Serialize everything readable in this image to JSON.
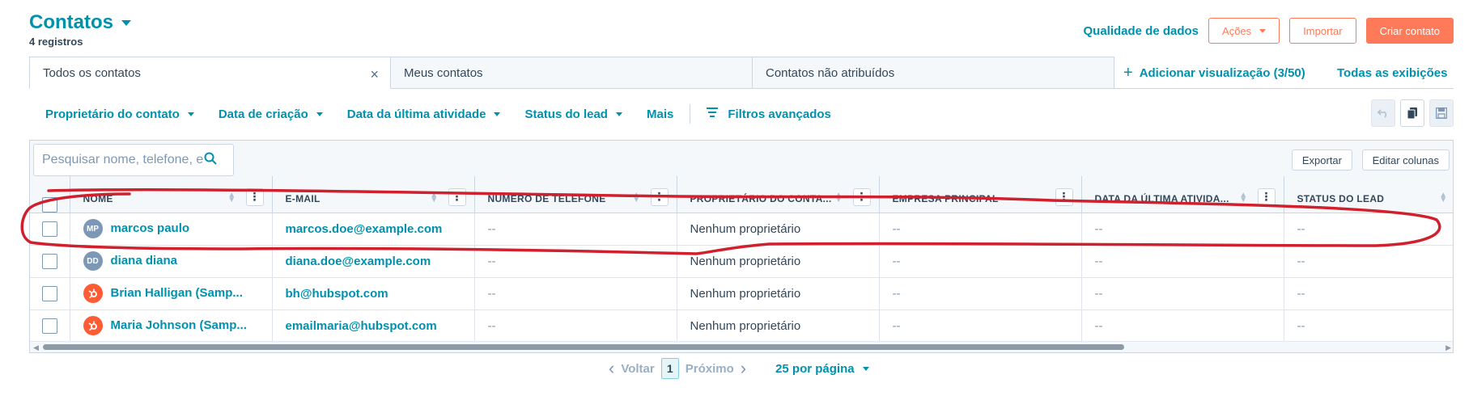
{
  "header": {
    "title": "Contatos",
    "subtitle": "4 registros",
    "quality_link": "Qualidade de dados",
    "actions_btn": "Ações",
    "import_btn": "Importar",
    "create_btn": "Criar contato"
  },
  "tabs": [
    {
      "label": "Todos os contatos",
      "close": "×"
    },
    {
      "label": "Meus contatos"
    },
    {
      "label": "Contatos não atribuídos"
    }
  ],
  "tab_extras": {
    "add_view": "Adicionar visualização (3/50)",
    "add_icon": "+",
    "all_views": "Todas as exibições"
  },
  "filters": {
    "items": [
      "Proprietário do contato",
      "Data de criação",
      "Data da última atividade",
      "Status do lead"
    ],
    "more": "Mais",
    "advanced": "Filtros avançados"
  },
  "table": {
    "search_placeholder": "Pesquisar nome, telefone, e",
    "export_btn": "Exportar",
    "edit_columns_btn": "Editar colunas",
    "columns": [
      "Nome",
      "E-mail",
      "Número de telefone",
      "Proprietário do conta...",
      "Empresa principal",
      "Data da última ativida...",
      "Status do lead"
    ],
    "rows": [
      {
        "initials": "MP",
        "name": "marcos paulo",
        "email": "marcos.doe@example.com",
        "phone": "--",
        "owner": "Nenhum proprietário",
        "company": "--",
        "last_activity": "--",
        "status": "--"
      },
      {
        "initials": "DD",
        "name": "diana diana",
        "email": "diana.doe@example.com",
        "phone": "--",
        "owner": "Nenhum proprietário",
        "company": "--",
        "last_activity": "--",
        "status": "--"
      },
      {
        "initials": "hubspot-icon",
        "name": "Brian Halligan (Samp...",
        "email": "bh@hubspot.com",
        "phone": "--",
        "owner": "Nenhum proprietário",
        "company": "--",
        "last_activity": "--",
        "status": "--"
      },
      {
        "initials": "hubspot-icon",
        "name": "Maria Johnson (Samp...",
        "email": "emailmaria@hubspot.com",
        "phone": "--",
        "owner": "Nenhum proprietário",
        "company": "--",
        "last_activity": "--",
        "status": "--"
      }
    ]
  },
  "pagination": {
    "prev": "Voltar",
    "page": "1",
    "next": "Próximo",
    "per_page": "25 por página"
  },
  "colors": {
    "accent": "#0091ae",
    "primary": "#ff7a59",
    "annotation": "#d0202e"
  }
}
